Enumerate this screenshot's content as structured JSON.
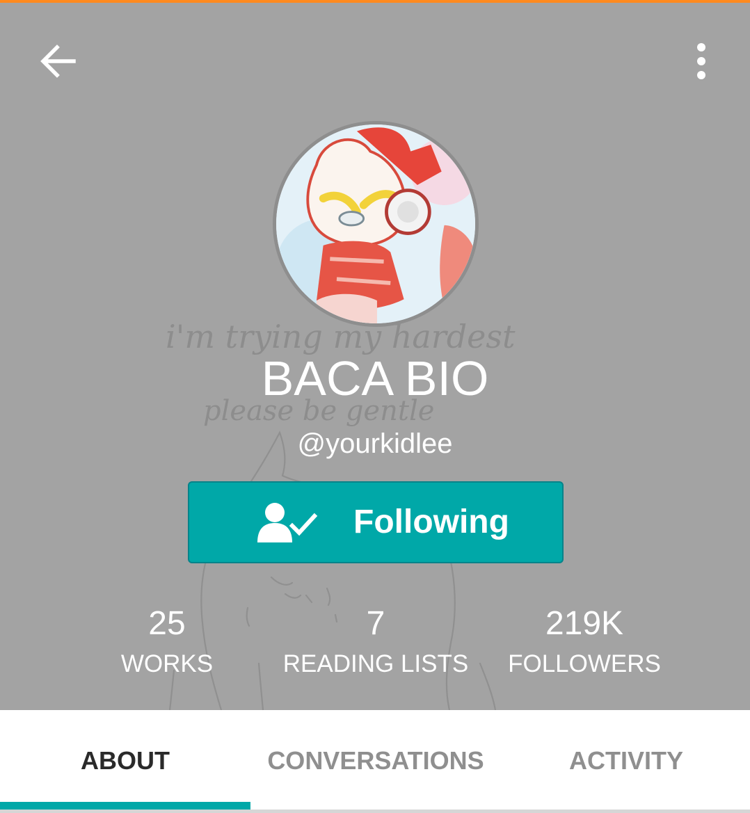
{
  "colors": {
    "accent_bar": "#ff8a1f",
    "header_bg": "#a3a3a3",
    "follow_button": "#00a8a8",
    "tab_active_text": "#2a2a2a",
    "tab_inactive_text": "#8f8f8f",
    "tab_indicator": "#00a8a8"
  },
  "toolbar": {
    "back_icon": "arrow-left-icon",
    "menu_icon": "more-vertical-icon"
  },
  "background_art": {
    "text_line_1": "i'm trying my hardest",
    "text_line_2": "please be gentle"
  },
  "profile": {
    "display_name": "BACA BIO",
    "username": "@yourkidlee",
    "avatar_icon": "profile-avatar-image"
  },
  "follow_button": {
    "label": "Following",
    "icon": "person-check-icon"
  },
  "stats": [
    {
      "value": "25",
      "label": "WORKS"
    },
    {
      "value": "7",
      "label": "READING LISTS"
    },
    {
      "value": "219K",
      "label": "FOLLOWERS"
    }
  ],
  "tabs": [
    {
      "label": "ABOUT",
      "active": true
    },
    {
      "label": "CONVERSATIONS",
      "active": false
    },
    {
      "label": "ACTIVITY",
      "active": false
    }
  ]
}
